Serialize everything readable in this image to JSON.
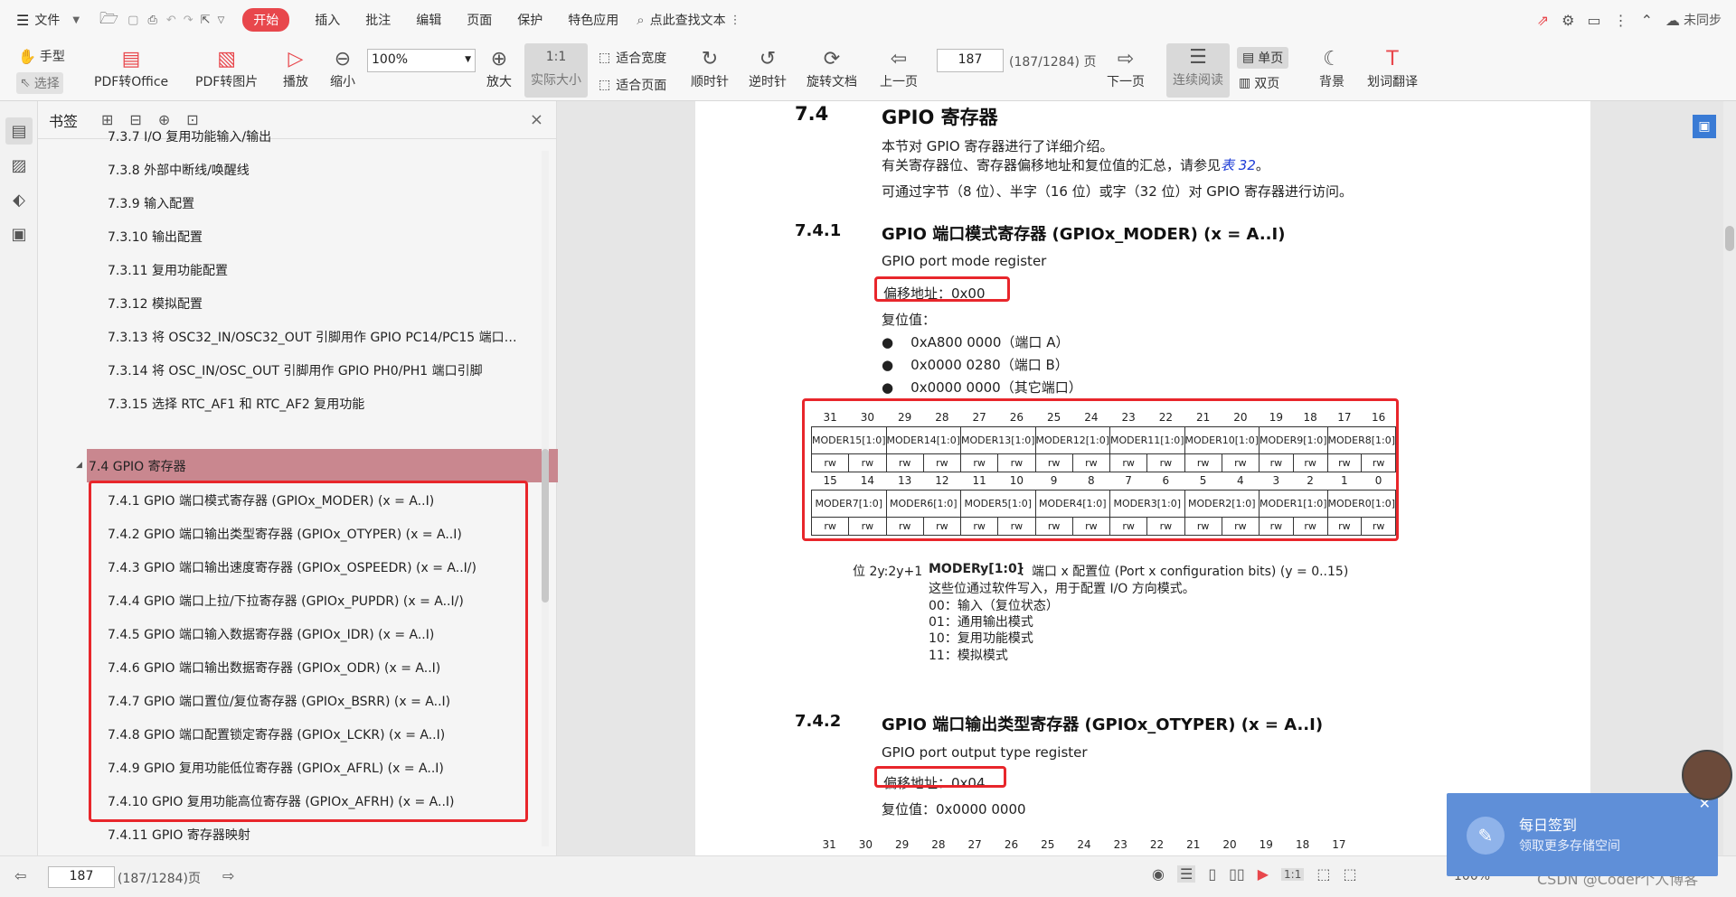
{
  "menubar": {
    "file": "文件",
    "items": [
      "开始",
      "插入",
      "批注",
      "编辑",
      "页面",
      "保护",
      "特色应用"
    ],
    "search": "点此查找文本",
    "sync": "未同步"
  },
  "toolbar": {
    "hand": "手型",
    "select": "选择",
    "pdf_to_office": "PDF转Office",
    "pdf_to_image": "PDF转图片",
    "play": "播放",
    "zoom_out": "缩小",
    "zoom_value": "100%",
    "zoom_in": "放大",
    "actual_size": "实际大小",
    "fit_width": "适合宽度",
    "fit_page": "适合页面",
    "clockwise": "顺时针",
    "counter_clockwise": "逆时针",
    "rotate": "旋转文档",
    "prev": "上一页",
    "page": "187",
    "page_total": "(187/1284) 页",
    "next": "下一页",
    "continuous": "连续阅读",
    "single": "单页",
    "double": "双页",
    "background": "背景",
    "translate": "划词翻译"
  },
  "bookmarks": {
    "title": "书签",
    "items": [
      "7.3.7 I/O 复用功能输入/输出",
      "7.3.8 外部中断线/唤醒线",
      "7.3.9 输入配置",
      "7.3.10 输出配置",
      "7.3.11 复用功能配置",
      "7.3.12 模拟配置",
      "7.3.13 将 OSC32_IN/OSC32_OUT 引脚用作 GPIO PC14/PC15 端口…",
      "7.3.14 将 OSC_IN/OSC_OUT 引脚用作 GPIO PH0/PH1 端口引脚",
      "7.3.15 选择 RTC_AF1 和 RTC_AF2 复用功能",
      "7.4 GPIO 寄存器",
      "7.4.1 GPIO 端口模式寄存器 (GPIOx_MODER) (x = A..I)",
      "7.4.2 GPIO 端口输出类型寄存器 (GPIOx_OTYPER) (x = A..I)",
      "7.4.3 GPIO 端口输出速度寄存器 (GPIOx_OSPEEDR) (x = A..I/)",
      "7.4.4 GPIO 端口上拉/下拉寄存器 (GPIOx_PUPDR) (x = A..I/)",
      "7.4.5 GPIO 端口输入数据寄存器 (GPIOx_IDR) (x = A..I)",
      "7.4.6 GPIO 端口输出数据寄存器 (GPIOx_ODR) (x = A..I)",
      "7.4.7 GPIO 端口置位/复位寄存器 (GPIOx_BSRR) (x = A..I)",
      "7.4.8 GPIO 端口配置锁定寄存器 (GPIOx_LCKR) (x = A..I)",
      "7.4.9 GPIO 复用功能低位寄存器 (GPIOx_AFRL) (x = A..I)",
      "7.4.10 GPIO 复用功能高位寄存器 (GPIOx_AFRH) (x = A..I)",
      "7.4.11 GPIO 寄存器映射"
    ]
  },
  "doc": {
    "sec_num": "7.4",
    "sec_title": "GPIO 寄存器",
    "intro1": "本节对 GPIO 寄存器进行了详细介绍。",
    "intro2a": "有关寄存器位、寄存器偏移地址和复位值的汇总，请参见",
    "intro2_link": "表 32",
    "intro2b": "。",
    "intro3": "可通过字节（8 位）、半字（16 位）或字（32 位）对 GPIO 寄存器进行访问。",
    "s1_num": "7.4.1",
    "s1_title": "GPIO 端口模式寄存器 (GPIOx_MODER) (x = A..I)",
    "s1_en": "GPIO port mode register",
    "s1_offset": "偏移地址：0x00",
    "s1_reset": "复位值：",
    "resets": [
      "0xA800 0000（端口 A）",
      "0x0000 0280（端口 B）",
      "0x0000 0000（其它端口）"
    ],
    "bits_hi": [
      "31",
      "30",
      "29",
      "28",
      "27",
      "26",
      "25",
      "24",
      "23",
      "22",
      "21",
      "20",
      "19",
      "18",
      "17",
      "16"
    ],
    "fields_hi": [
      "MODER15[1:0]",
      "MODER14[1:0]",
      "MODER13[1:0]",
      "MODER12[1:0]",
      "MODER11[1:0]",
      "MODER10[1:0]",
      "MODER9[1:0]",
      "MODER8[1:0]"
    ],
    "bits_lo": [
      "15",
      "14",
      "13",
      "12",
      "11",
      "10",
      "9",
      "8",
      "7",
      "6",
      "5",
      "4",
      "3",
      "2",
      "1",
      "0"
    ],
    "fields_lo": [
      "MODER7[1:0]",
      "MODER6[1:0]",
      "MODER5[1:0]",
      "MODER4[1:0]",
      "MODER3[1:0]",
      "MODER2[1:0]",
      "MODER1[1:0]",
      "MODER0[1:0]"
    ],
    "rw": "rw",
    "bitdesc_pos": "位 2y:2y+1",
    "bitdesc_name": "MODERy[1:0]",
    "bitdesc_text": "：端口 x 配置位 (Port x configuration bits) (y = 0..15)",
    "bitdesc_l1": "这些位通过软件写入，用于配置 I/O 方向模式。",
    "modes": [
      "00：输入（复位状态）",
      "01：通用输出模式",
      "10：复用功能模式",
      "11：模拟模式"
    ],
    "s2_num": "7.4.2",
    "s2_title": "GPIO 端口输出类型寄存器 (GPIOx_OTYPER) (x = A..I)",
    "s2_en": "GPIO port output type register",
    "s2_offset": "偏移地址：0x04",
    "s2_reset": "复位值：0x0000 0000",
    "bits_hi2": [
      "31",
      "30",
      "29",
      "28",
      "27",
      "26",
      "25",
      "24",
      "23",
      "22",
      "21",
      "20",
      "19",
      "18",
      "17"
    ]
  },
  "status": {
    "page": "187",
    "total": "(187/1284)页",
    "zoom": "100%",
    "watermark": "CSDN @Coder个人博客"
  },
  "toast": {
    "title": "每日签到",
    "sub": "领取更多存储空间"
  }
}
